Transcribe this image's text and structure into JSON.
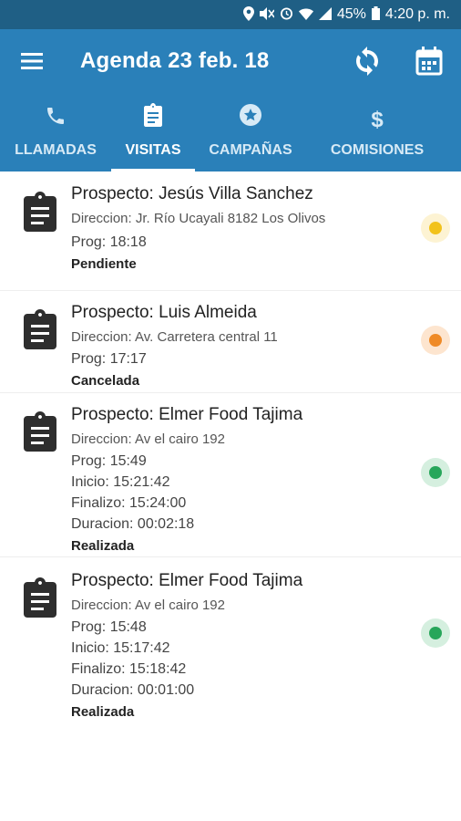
{
  "status_bar": {
    "battery": "45%",
    "time": "4:20 p. m."
  },
  "header": {
    "title": "Agenda 23 feb. 18"
  },
  "tabs": [
    {
      "label": "LLAMADAS",
      "icon": "phone-icon"
    },
    {
      "label": "VISITAS",
      "icon": "clipboard-icon",
      "active": true
    },
    {
      "label": "CAMPAÑAS",
      "icon": "star-badge-icon"
    },
    {
      "label": "COMISIONES",
      "icon": "dollar-icon"
    }
  ],
  "visits": [
    {
      "prospect": "Prospecto: Jesús Villa Sanchez",
      "address": "Direccion: Jr. Río Ucayali 8182 Los Olivos",
      "prog": "Prog: 18:18",
      "status": "Pendiente",
      "status_color": "#f2c21b"
    },
    {
      "prospect": "Prospecto: Luis Almeida",
      "address": "Direccion: Av. Carretera central 11",
      "prog": "Prog: 17:17",
      "status": "Cancelada",
      "status_color": "#ef8a26"
    },
    {
      "prospect": "Prospecto: Elmer Food Tajima",
      "address": "Direccion: Av el cairo 192",
      "prog": "Prog: 15:49",
      "inicio": "Inicio: 15:21:42",
      "finalizo": "Finalizo: 15:24:00",
      "duracion": "Duracion: 00:02:18",
      "status": "Realizada",
      "status_color": "#27a65a"
    },
    {
      "prospect": "Prospecto: Elmer Food Tajima",
      "address": "Direccion: Av el cairo 192",
      "prog": "Prog: 15:48",
      "inicio": "Inicio: 15:17:42",
      "finalizo": "Finalizo: 15:18:42",
      "duracion": "Duracion: 00:01:00",
      "status": "Realizada",
      "status_color": "#27a65a"
    }
  ]
}
